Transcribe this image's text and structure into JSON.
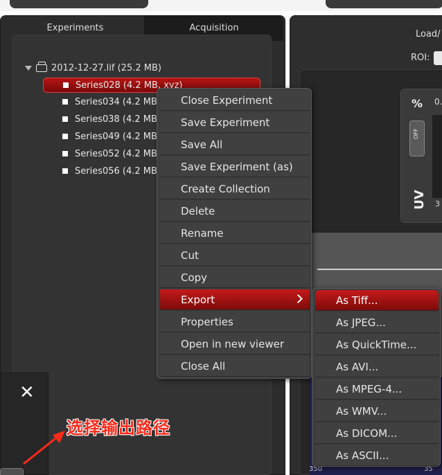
{
  "tabs": [
    {
      "label": "Experiments"
    },
    {
      "label": "Acquisition"
    }
  ],
  "tree": {
    "root": "2012-12-27.lif (25.2 MB)",
    "items": [
      {
        "label": "Series028 (4.2 MB, xyz)"
      },
      {
        "label": "Series034 (4.2 MB"
      },
      {
        "label": "Series038 (4.2 MB"
      },
      {
        "label": "Series049 (4.2 MB"
      },
      {
        "label": "Series052 (4.2 MB"
      },
      {
        "label": "Series056 (4.2 MB"
      }
    ],
    "selected_index": 0
  },
  "right_panel": {
    "load_label": "Load/",
    "roi_label": "ROI:",
    "percent_label": "%",
    "zero_label": "0.",
    "toggle_label": "OFF",
    "uv_label": "UV",
    "three_label": "3",
    "tick_left": "350",
    "tick_right": "35"
  },
  "context_menu": {
    "items": [
      "Close Experiment",
      "Save Experiment",
      "Save All",
      "Save Experiment (as)",
      "Create Collection",
      "Delete",
      "Rename",
      "Cut",
      "Copy",
      "Export",
      "Properties",
      "Open in new viewer",
      "Close All"
    ],
    "active_item": "Export"
  },
  "export_submenu": {
    "items": [
      "As Tiff...",
      "As JPEG...",
      "As QuickTime...",
      "As AVI...",
      "As MPEG-4...",
      "As WMV...",
      "As DICOM...",
      "As ASCII..."
    ],
    "active_item": "As Tiff..."
  },
  "small_panel": {
    "close_symbol": "✕"
  },
  "annotation": {
    "text": "选择输出路径",
    "color": "#ff2a1a"
  },
  "colors": {
    "highlight": "#b51414",
    "panel": "#2c2c2c",
    "menu": "#3d3d3d"
  }
}
